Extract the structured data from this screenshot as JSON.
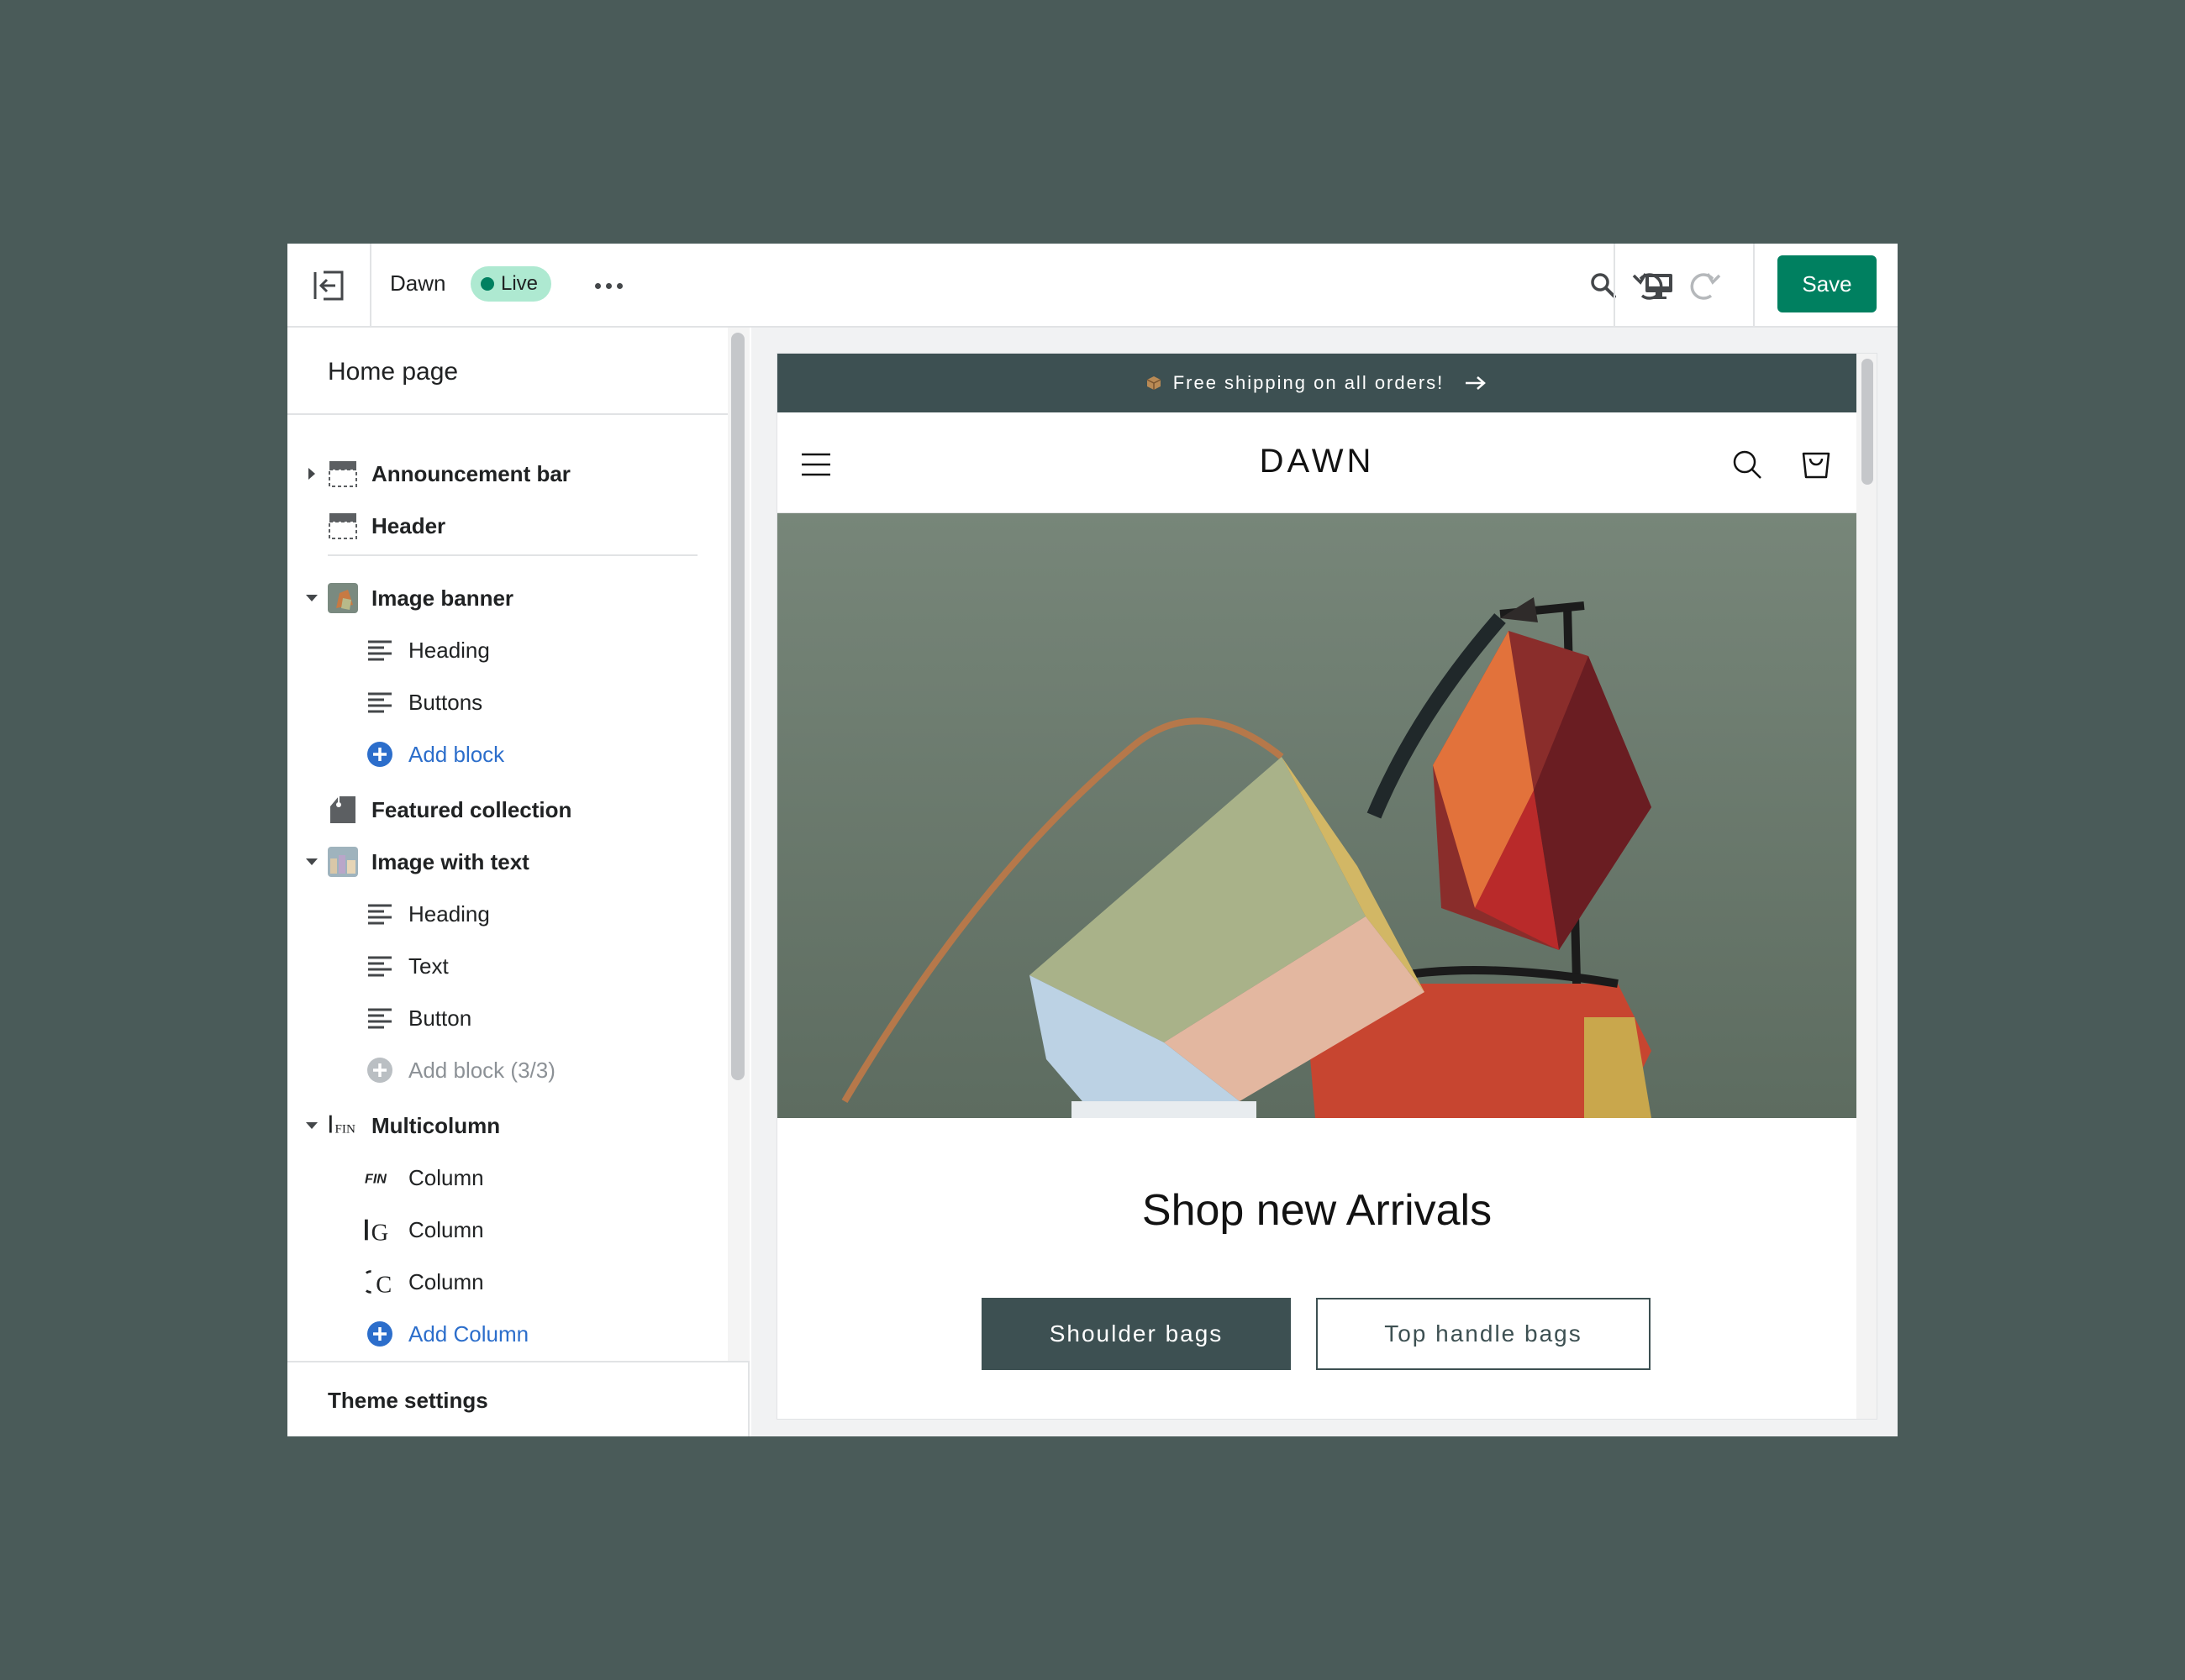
{
  "topbar": {
    "theme_name": "Dawn",
    "status": "Live",
    "save_label": "Save",
    "icons": [
      "exit-icon",
      "more-icon",
      "search-icon",
      "desktop-icon",
      "undo-icon",
      "redo-icon"
    ]
  },
  "sidebar": {
    "title": "Home page",
    "sections": [
      {
        "label": "Announcement bar",
        "icon": "section-top-icon",
        "expanded": false
      },
      {
        "label": "Header",
        "icon": "section-top-icon"
      },
      {
        "label": "Image banner",
        "icon": "image-thumb-icon",
        "expanded": true,
        "blocks": [
          "Heading",
          "Buttons"
        ],
        "add_label": "Add block"
      },
      {
        "label": "Featured collection",
        "icon": "tag-icon"
      },
      {
        "label": "Image with text",
        "icon": "image-thumb-icon",
        "expanded": true,
        "blocks": [
          "Heading",
          "Text",
          "Button"
        ],
        "add_label": "Add block (3/3)"
      },
      {
        "label": "Multicolumn",
        "icon": "multicolumn-icon",
        "expanded": true,
        "blocks": [
          "Column",
          "Column",
          "Column"
        ],
        "add_label": "Add Column"
      }
    ],
    "column_thumbs": [
      "FIN",
      "G",
      "C"
    ],
    "footer_label": "Theme settings"
  },
  "preview": {
    "announcement": "Free shipping on all orders!",
    "store_logo": "DAWN",
    "hero_title": "Shop new Arrivals",
    "button_primary": "Shoulder bags",
    "button_secondary": "Top handle bags"
  },
  "colors": {
    "accent": "#008060",
    "live_badge": "#aee9d1",
    "link": "#2c6ecb",
    "store_dark": "#3d5052",
    "background": "#4a5b59"
  }
}
